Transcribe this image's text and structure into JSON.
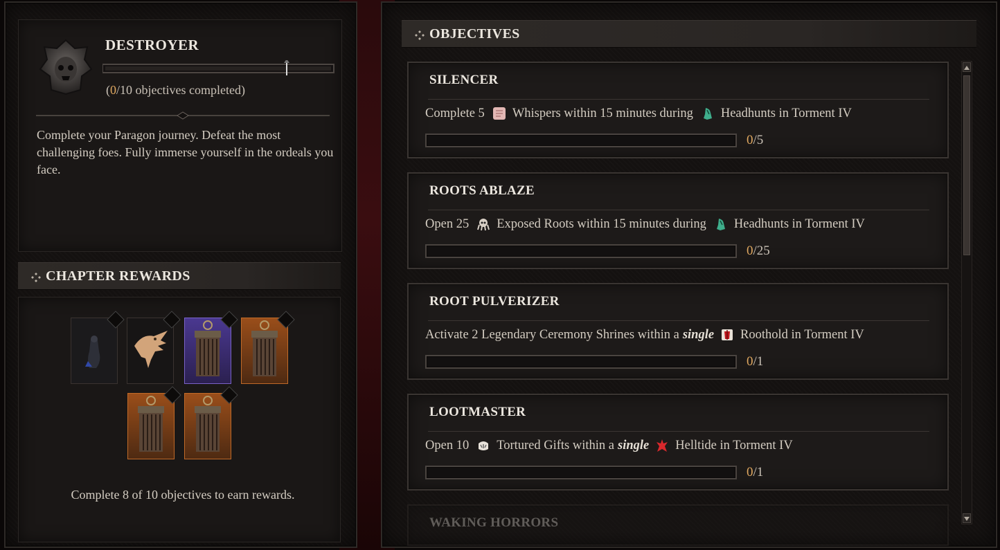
{
  "chapter": {
    "title": "DESTROYER",
    "progress_current": "0",
    "progress_suffix": "/10 objectives completed)",
    "progress_prefix": "(",
    "progress_fraction": 0,
    "description": "Complete your Paragon journey. Defeat the most challenging foes. Fully immerse yourself in the ordeals you face."
  },
  "rewards": {
    "header": "CHAPTER REWARDS",
    "note": "Complete 8 of 10 objectives to earn rewards.",
    "items": [
      {
        "icon": "raven-figure-icon",
        "tier": "common"
      },
      {
        "icon": "raven-emblem-icon",
        "tier": "common"
      },
      {
        "icon": "cage-cache-icon",
        "tier": "mythic"
      },
      {
        "icon": "cage-cache-icon",
        "tier": "legendary"
      },
      {
        "icon": "cage-cache-icon",
        "tier": "legendary"
      },
      {
        "icon": "cage-cache-icon",
        "tier": "legendary"
      }
    ]
  },
  "objectives_panel": {
    "header": "OBJECTIVES",
    "items": [
      {
        "title": "SILENCER",
        "pre": "Complete 5",
        "icon1": "whisper-scroll-icon",
        "mid": "Whispers within 15 minutes during",
        "emph": "",
        "icon2": "headhunt-icon",
        "post": "Headhunts in Torment IV",
        "current": "0",
        "total": "/5"
      },
      {
        "title": "ROOTS ABLAZE",
        "pre": "Open 25",
        "icon1": "exposed-root-icon",
        "mid": "Exposed Roots within 15 minutes during",
        "emph": "",
        "icon2": "headhunt-icon",
        "post": "Headhunts in Torment IV",
        "current": "0",
        "total": "/25"
      },
      {
        "title": "ROOT PULVERIZER",
        "pre": "Activate 2 Legendary Ceremony Shrines within a",
        "icon1": "",
        "mid": "",
        "emph": "single",
        "icon2": "roothold-icon",
        "post": "Roothold in Torment IV",
        "current": "0",
        "total": "/1"
      },
      {
        "title": "LOOTMASTER",
        "pre": "Open 10",
        "icon1": "tortured-gift-icon",
        "mid": "Tortured Gifts within a",
        "emph": "single",
        "icon2": "helltide-icon",
        "post": "Helltide in Torment IV",
        "current": "0",
        "total": "/1"
      },
      {
        "title": "WAKING HORRORS",
        "pre": "",
        "icon1": "",
        "mid": "",
        "emph": "",
        "icon2": "",
        "post": "",
        "current": "",
        "total": ""
      }
    ]
  },
  "colors": {
    "accent": "#e0a860",
    "mythic": "#6a4fb0",
    "legendary": "#b8601e"
  }
}
